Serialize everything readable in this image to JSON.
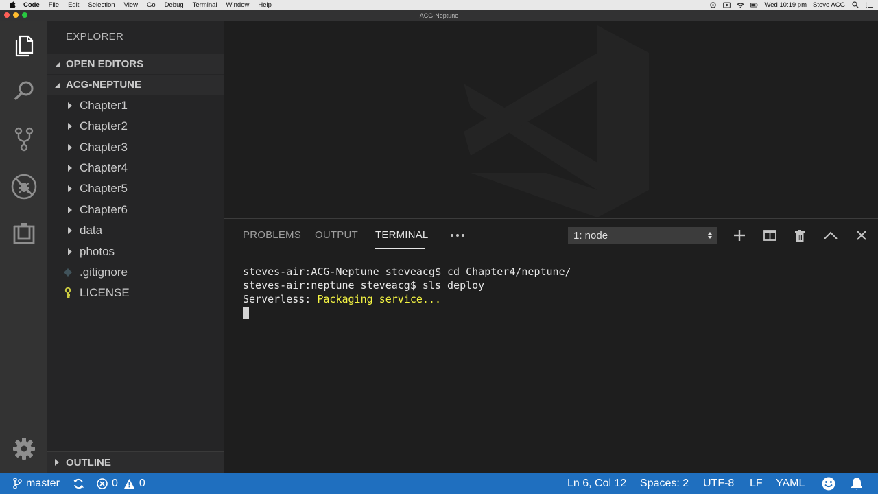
{
  "menubar": {
    "app_name": "Code",
    "items": [
      "File",
      "Edit",
      "Selection",
      "View",
      "Go",
      "Debug",
      "Terminal",
      "Window",
      "Help"
    ],
    "clock": "Wed 10:19 pm",
    "user": "Steve ACG"
  },
  "window": {
    "title": "ACG-Neptune"
  },
  "sidebar": {
    "title": "EXPLORER",
    "open_editors": "OPEN EDITORS",
    "folder": "ACG-NEPTUNE",
    "items": [
      {
        "label": "Chapter1",
        "type": "folder"
      },
      {
        "label": "Chapter2",
        "type": "folder"
      },
      {
        "label": "Chapter3",
        "type": "folder"
      },
      {
        "label": "Chapter4",
        "type": "folder"
      },
      {
        "label": "Chapter5",
        "type": "folder"
      },
      {
        "label": "Chapter6",
        "type": "folder"
      },
      {
        "label": "data",
        "type": "folder"
      },
      {
        "label": "photos",
        "type": "folder"
      },
      {
        "label": ".gitignore",
        "type": "file"
      },
      {
        "label": "LICENSE",
        "type": "file"
      }
    ],
    "outline": "OUTLINE"
  },
  "panel": {
    "tabs": [
      "PROBLEMS",
      "OUTPUT",
      "TERMINAL"
    ],
    "active_tab": "TERMINAL",
    "terminal_select": "1: node"
  },
  "terminal": {
    "line1": "steves-air:ACG-Neptune steveacg$ cd Chapter4/neptune/",
    "line2": "steves-air:neptune steveacg$ sls deploy",
    "line3_prefix": "Serverless: ",
    "line3_highlight": "Packaging service..."
  },
  "statusbar": {
    "branch": "master",
    "errors": "0",
    "warnings": "0",
    "position": "Ln 6, Col 12",
    "spaces": "Spaces: 2",
    "encoding": "UTF-8",
    "eol": "LF",
    "language": "YAML"
  },
  "colors": {
    "statusbar": "#1f6fbf",
    "terminal_highlight": "#f5f543",
    "activity_bar": "#333333",
    "sidebar": "#252526",
    "editor": "#1e1e1e"
  }
}
